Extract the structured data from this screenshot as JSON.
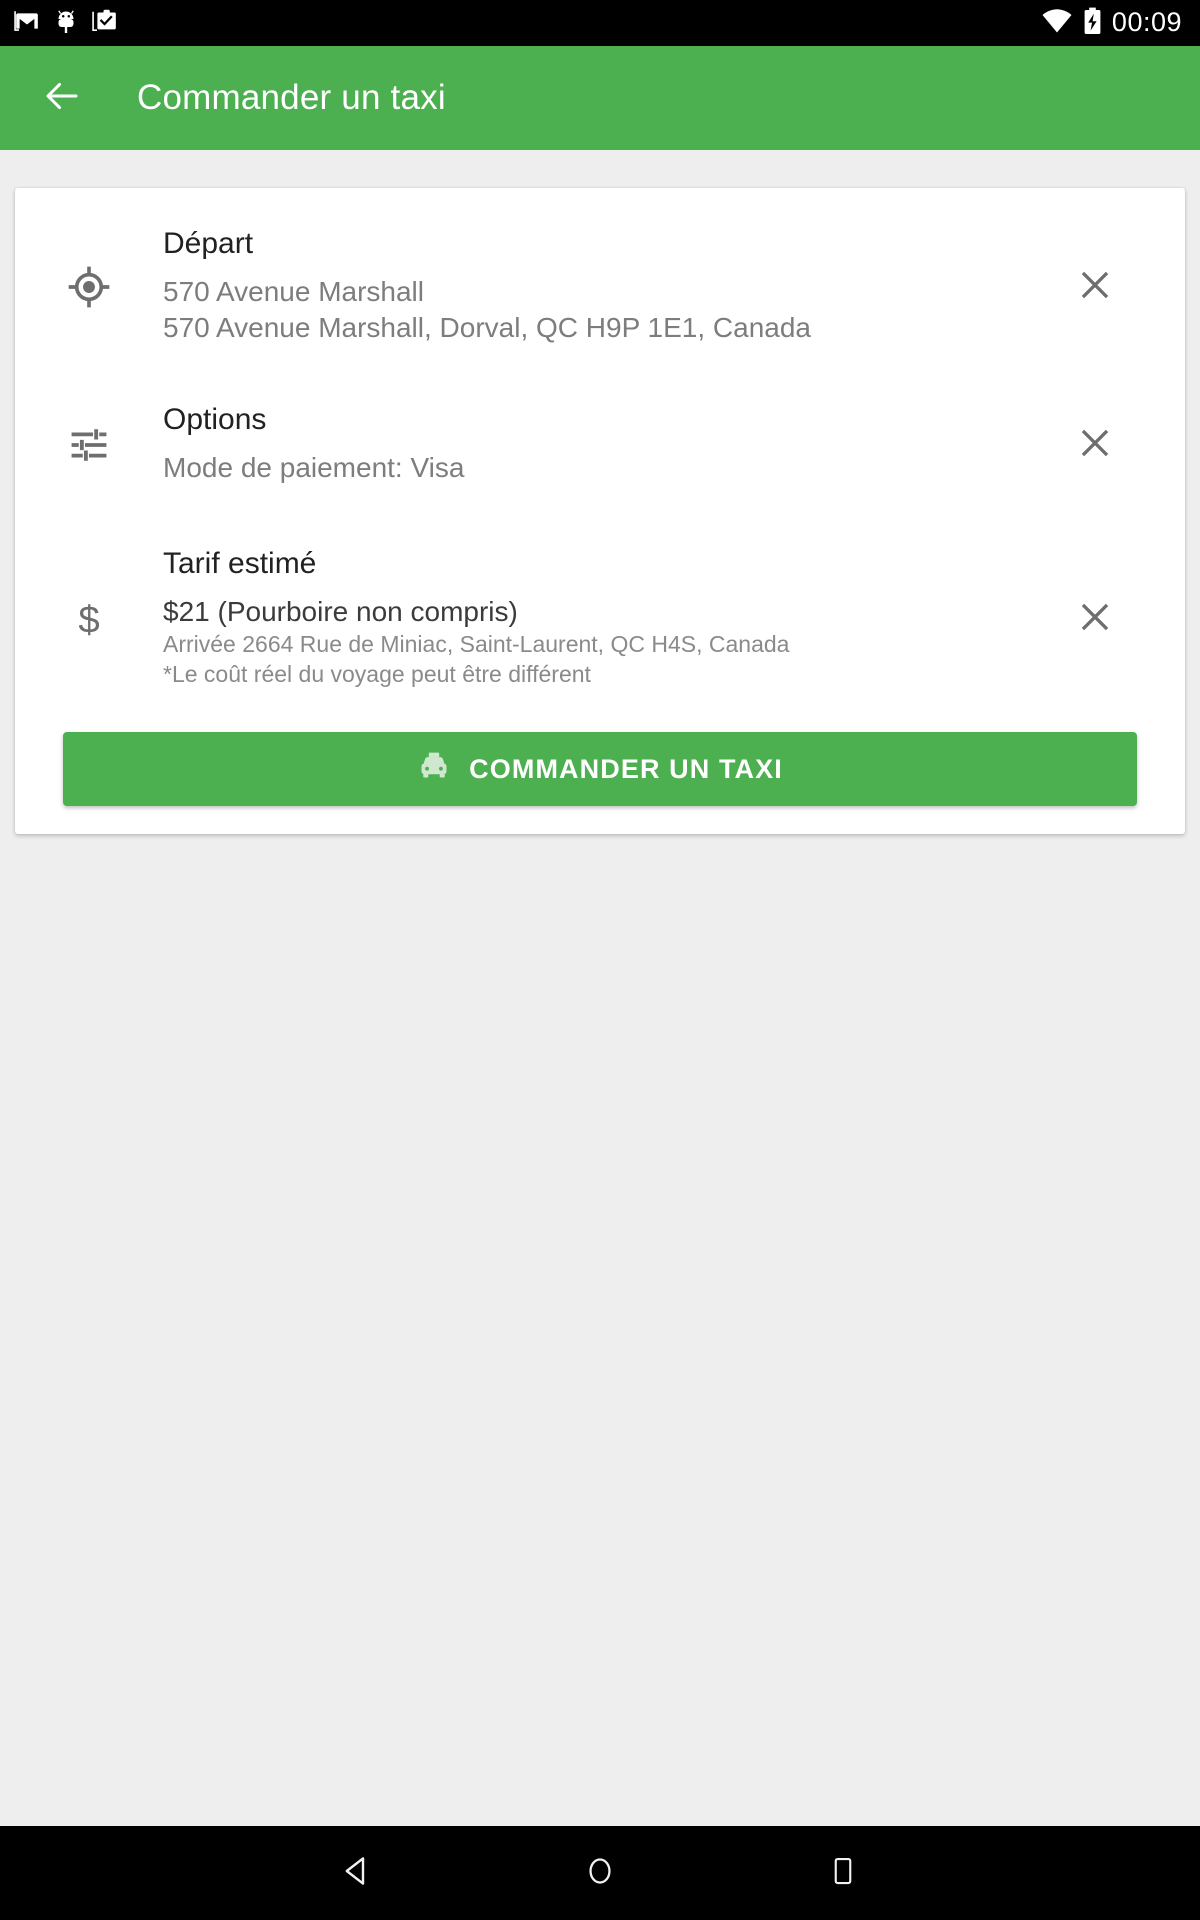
{
  "status_bar": {
    "icons": [
      "gmail-icon",
      "android-bug-icon",
      "clipboard-check-icon"
    ],
    "wifi": "wifi-icon",
    "battery": "battery-charging-icon",
    "time": "00:09"
  },
  "app_bar": {
    "back": "back-arrow-icon",
    "title": "Commander un taxi"
  },
  "card": {
    "rows": [
      {
        "icon": "gps-crosshair-icon",
        "title": "Départ",
        "line1": "570 Avenue Marshall",
        "line2": "570 Avenue Marshall, Dorval, QC H9P 1E1, Canada",
        "close": "close-icon"
      },
      {
        "icon": "tune-sliders-icon",
        "title": "Options",
        "line1": "Mode de paiement: Visa",
        "close": "close-icon"
      },
      {
        "icon": "dollar-sign-icon",
        "title": "Tarif estimé",
        "line1": "$21 (Pourboire non compris)",
        "line2": "Arrivée 2664 Rue de Miniac, Saint-Laurent, QC H4S, Canada",
        "line3": "*Le coût réel du voyage peut être différent",
        "close": "close-icon"
      }
    ],
    "order_button": {
      "icon": "taxi-icon",
      "label": "COMMANDER UN TAXI"
    }
  },
  "nav_bar": {
    "back": "nav-back-triangle-icon",
    "home": "nav-home-circle-icon",
    "recents": "nav-recents-square-icon"
  },
  "colors": {
    "accent_green": "#4CAF50",
    "page_background": "#eeeeee",
    "card_background": "#ffffff",
    "status_bar": "#000000",
    "primary_text": "#212121",
    "secondary_text": "#7d7d7d"
  }
}
